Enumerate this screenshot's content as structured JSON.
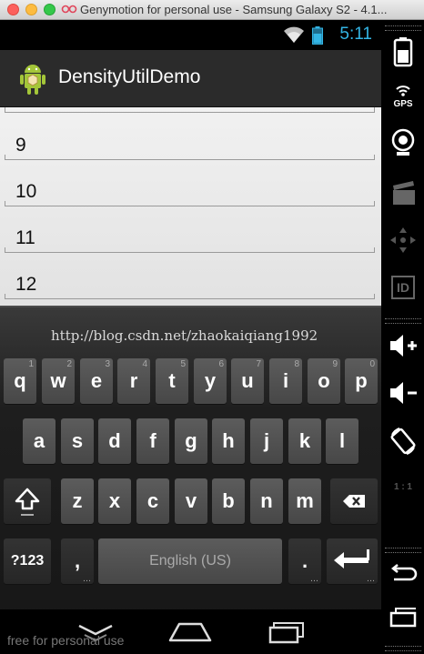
{
  "window": {
    "title": "Genymotion for personal use - Samsung Galaxy S2 - 4.1..."
  },
  "statusbar": {
    "time": "5:11"
  },
  "actionbar": {
    "title": "DensityUtilDemo"
  },
  "list": {
    "items": [
      "9",
      "10",
      "11",
      "12"
    ]
  },
  "keyboard": {
    "watermark": "http://blog.csdn.net/zhaokaiqiang1992",
    "row1": [
      {
        "label": "q",
        "hint": "1"
      },
      {
        "label": "w",
        "hint": "2"
      },
      {
        "label": "e",
        "hint": "3"
      },
      {
        "label": "r",
        "hint": "4"
      },
      {
        "label": "t",
        "hint": "5"
      },
      {
        "label": "y",
        "hint": "6"
      },
      {
        "label": "u",
        "hint": "7"
      },
      {
        "label": "i",
        "hint": "8"
      },
      {
        "label": "o",
        "hint": "9"
      },
      {
        "label": "p",
        "hint": "0"
      }
    ],
    "row2": [
      "a",
      "s",
      "d",
      "f",
      "g",
      "h",
      "j",
      "k",
      "l"
    ],
    "row3": [
      "z",
      "x",
      "c",
      "v",
      "b",
      "n",
      "m"
    ],
    "symbols_label": "?123",
    "comma_label": ",",
    "space_label": "English (US)",
    "period_label": "."
  },
  "footer": {
    "text": "free for personal use"
  },
  "sidebar": {
    "gps_label": "GPS",
    "id_label": "ID",
    "scale_label": "1 : 1"
  },
  "colors": {
    "accent": "#33b5e5",
    "actionbar": "#2b2b2b"
  }
}
